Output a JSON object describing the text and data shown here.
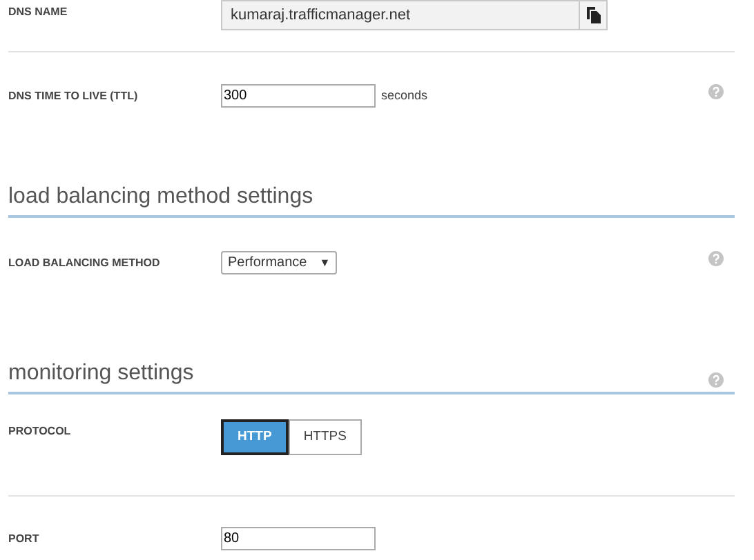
{
  "items": [
    {
      "kind": "row",
      "label": "DNS NAME",
      "control": {
        "kind": "readonly-copy",
        "value": "kumaraj.trafficmanager.net"
      },
      "help": false
    },
    {
      "kind": "row",
      "label": "DNS TIME TO LIVE (TTL)",
      "control": {
        "kind": "text-input",
        "value": "300",
        "suffix": "seconds"
      },
      "help": true
    },
    {
      "kind": "heading",
      "title": "load balancing method settings",
      "help": false
    },
    {
      "kind": "row",
      "label": "LOAD BALANCING METHOD",
      "control": {
        "kind": "select",
        "value": "Performance",
        "caret": "▼"
      },
      "help": true
    },
    {
      "kind": "heading",
      "title": "monitoring settings",
      "help": true
    },
    {
      "kind": "row",
      "label": "PROTOCOL",
      "control": {
        "kind": "toggle",
        "options": [
          {
            "label": "HTTP",
            "selected": true
          },
          {
            "label": "HTTPS",
            "selected": false
          }
        ]
      },
      "help": false
    },
    {
      "kind": "row",
      "label": "PORT",
      "control": {
        "kind": "text-input",
        "value": "80"
      },
      "help": false
    }
  ]
}
